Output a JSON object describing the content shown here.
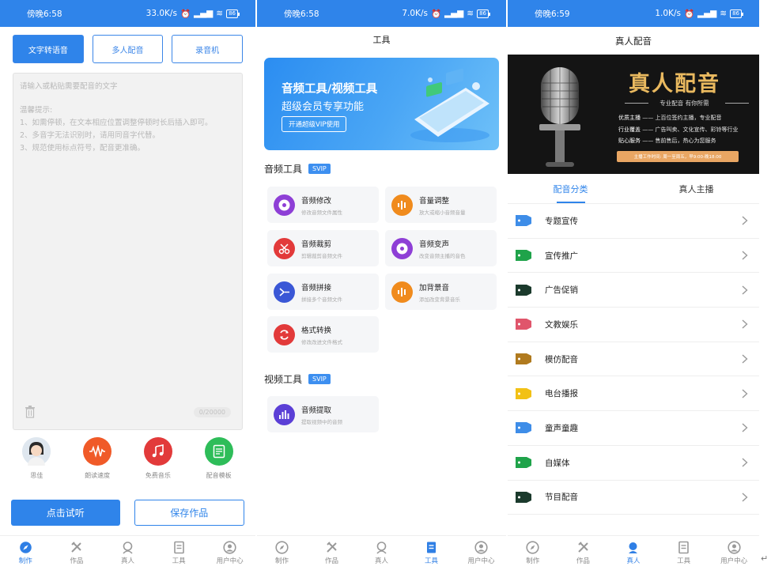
{
  "screens": [
    {
      "status": {
        "time": "傍晚6:58",
        "speed": "33.0K/s",
        "battery": "86"
      },
      "modes": [
        {
          "label": "文字转语音",
          "active": true
        },
        {
          "label": "多人配音",
          "active": false
        },
        {
          "label": "录音机",
          "active": false
        }
      ],
      "editor": {
        "placeholder": "请输入或粘贴需要配音的文字",
        "tips_title": "温馨提示:",
        "tips": [
          "1、如需停顿，在文本相应位置调整停顿时长后插入即可。",
          "2、多音字无法识别时，请用同音字代替。",
          "3、规范使用标点符号，配音更准确。"
        ],
        "counter": "0/20000"
      },
      "tools": [
        {
          "label": "思佳",
          "icon": "avatar-icon",
          "color": "#e8eef4"
        },
        {
          "label": "朗读速度",
          "icon": "waveform-icon",
          "color": "#f05a28"
        },
        {
          "label": "免费音乐",
          "icon": "music-note-icon",
          "color": "#e23a3a"
        },
        {
          "label": "配音模板",
          "icon": "template-icon",
          "color": "#2ebd59"
        }
      ],
      "actions": {
        "listen": "点击试听",
        "save": "保存作品"
      },
      "tabs": [
        {
          "label": "制作",
          "icon": "compass-icon",
          "active": true
        },
        {
          "label": "作品",
          "icon": "works-icon",
          "active": false
        },
        {
          "label": "真人",
          "icon": "person-icon",
          "active": false
        },
        {
          "label": "工具",
          "icon": "tools-icon",
          "active": false
        },
        {
          "label": "用户中心",
          "icon": "user-icon",
          "active": false
        }
      ]
    },
    {
      "status": {
        "time": "傍晚6:58",
        "speed": "7.0K/s",
        "battery": "86"
      },
      "title": "工具",
      "banner": {
        "line1": "音频工具/视频工具",
        "line2": "超级会员专享功能",
        "button": "开通超级VIP使用"
      },
      "audio_section": {
        "title": "音频工具",
        "badge": "SVIP"
      },
      "audio_tools": [
        {
          "title": "音频修改",
          "sub": "修改音频文件属性",
          "color": "#8e3fd6",
          "icon": "disc-icon"
        },
        {
          "title": "音量调整",
          "sub": "放大或缩小音频音量",
          "color": "#f08b1d",
          "icon": "volume-icon"
        },
        {
          "title": "音频裁剪",
          "sub": "剪辑裁剪音频文件",
          "color": "#e23a3a",
          "icon": "scissors-icon"
        },
        {
          "title": "音频变声",
          "sub": "改变音频主播的音色",
          "color": "#8e3fd6",
          "icon": "disc-icon"
        },
        {
          "title": "音频拼接",
          "sub": "拼接多个音频文件",
          "color": "#3a57d6",
          "icon": "merge-icon"
        },
        {
          "title": "加背景音",
          "sub": "添加改变背景音乐",
          "color": "#f08b1d",
          "icon": "volume-icon"
        },
        {
          "title": "格式转换",
          "sub": "修改改进文件格式",
          "color": "#e23a3a",
          "icon": "convert-icon"
        }
      ],
      "video_section": {
        "title": "视频工具",
        "badge": "SVIP"
      },
      "video_tools": [
        {
          "title": "音频提取",
          "sub": "提取视频中的音频",
          "color": "#5b3fd6",
          "icon": "bars-icon"
        }
      ],
      "tabs": [
        {
          "label": "制作",
          "icon": "compass-icon",
          "active": false
        },
        {
          "label": "作品",
          "icon": "works-icon",
          "active": false
        },
        {
          "label": "真人",
          "icon": "person-icon",
          "active": false
        },
        {
          "label": "工具",
          "icon": "tools-icon",
          "active": true
        },
        {
          "label": "用户中心",
          "icon": "user-icon",
          "active": false
        }
      ]
    },
    {
      "status": {
        "time": "傍晚6:59",
        "speed": "1.0K/s",
        "battery": "86"
      },
      "title": "真人配音",
      "banner": {
        "title": "真人配音",
        "subtitle": "专业配音 有你所需",
        "rows": [
          {
            "k": "优质主播",
            "v": "上百位签约主播，专业配音"
          },
          {
            "k": "行业覆盖",
            "v": "广告叫卖、文化宣传、彩铃等行业"
          },
          {
            "k": "贴心服务",
            "v": "售前售后，热心为您服务"
          }
        ],
        "hours": "主播工作时间: 周一至周五，早9:00-晚18:00"
      },
      "tabs_top": [
        {
          "label": "配音分类",
          "active": true
        },
        {
          "label": "真人主播",
          "active": false
        }
      ],
      "categories": [
        {
          "label": "专题宣传",
          "color": "#3e8de8"
        },
        {
          "label": "宣传推广",
          "color": "#1fa34a"
        },
        {
          "label": "广告促销",
          "color": "#1b3a2c"
        },
        {
          "label": "文教娱乐",
          "color": "#e0556b"
        },
        {
          "label": "模仿配音",
          "color": "#b07a1e"
        },
        {
          "label": "电台播报",
          "color": "#f2c115"
        },
        {
          "label": "童声童趣",
          "color": "#3e8de8"
        },
        {
          "label": "自媒体",
          "color": "#1fa34a"
        },
        {
          "label": "节目配音",
          "color": "#1b3a2c"
        }
      ],
      "tabs": [
        {
          "label": "制作",
          "icon": "compass-icon",
          "active": false
        },
        {
          "label": "作品",
          "icon": "works-icon",
          "active": false
        },
        {
          "label": "真人",
          "icon": "person-icon",
          "active": true
        },
        {
          "label": "工具",
          "icon": "tools-icon",
          "active": false
        },
        {
          "label": "用户中心",
          "icon": "user-icon",
          "active": false
        }
      ]
    }
  ]
}
